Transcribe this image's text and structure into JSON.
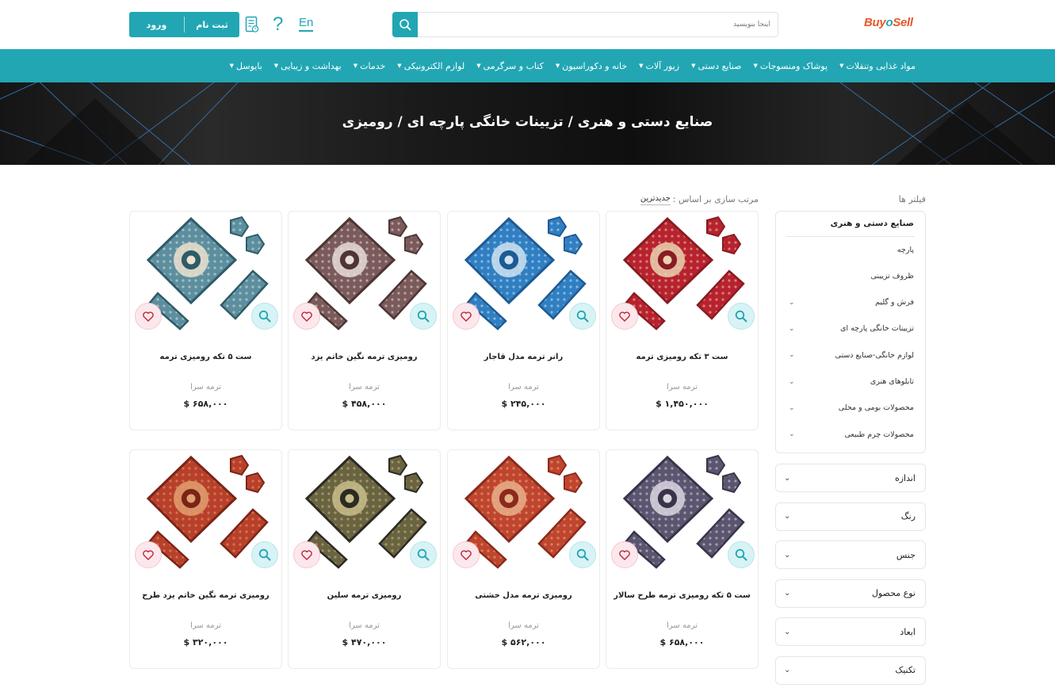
{
  "header": {
    "logo_part1": "Buy",
    "logo_o": "o",
    "logo_part2": "Sell",
    "search_placeholder": "اینجا بنویسید",
    "lang_link": "En",
    "help_glyph": "?",
    "register_label": "ثبت نام",
    "login_label": "ورود",
    "accent_color": "#22a6b3"
  },
  "nav": {
    "items": [
      {
        "label": "مواد غذایی وتنقلات"
      },
      {
        "label": "پوشاک ومنسوجات"
      },
      {
        "label": "صنایع دستی"
      },
      {
        "label": "زیور آلات"
      },
      {
        "label": "خانه و دکوراسیون"
      },
      {
        "label": "کتاب و سرگرمی"
      },
      {
        "label": "لوازم الکترونیکی"
      },
      {
        "label": "خدمات"
      },
      {
        "label": "بهداشت و زیبایی"
      },
      {
        "label": "بایوسل"
      }
    ]
  },
  "banner": {
    "title": "صنایع دستی و هنری / تزیینات خانگی پارچه ای / رومیزی"
  },
  "sidebar": {
    "filters_title": "فیلتر ها",
    "category_head": "صنایع دستی و هنری",
    "category_items": [
      {
        "label": "پارچه",
        "has_children": false
      },
      {
        "label": "ظروف تزیینی",
        "has_children": false
      },
      {
        "label": "فرش و گلیم",
        "has_children": true
      },
      {
        "label": "تزیینات خانگی پارچه ای",
        "has_children": true
      },
      {
        "label": "لوازم خانگی-صنایع دستی",
        "has_children": true
      },
      {
        "label": "تابلوهای هنری",
        "has_children": true
      },
      {
        "label": "محصولات بومی و محلی",
        "has_children": true
      },
      {
        "label": "محصولات چرم طبیعی",
        "has_children": true
      }
    ],
    "filter_groups": [
      {
        "label": "اندازه"
      },
      {
        "label": "رنگ"
      },
      {
        "label": "جنس"
      },
      {
        "label": "نوع محصول"
      },
      {
        "label": "ابعاد"
      },
      {
        "label": "تکنیک"
      }
    ]
  },
  "sort": {
    "label": "مرتب سازی بر اساس :",
    "value": "جدیدترین"
  },
  "products": [
    {
      "name": "ست ۳ تکه رومیزی ترمه",
      "brand": "ترمه سرا",
      "price": "$ ۱,۴۵۰,۰۰۰",
      "palette": [
        "#b8222e",
        "#e9d3b0",
        "#8a1b22"
      ]
    },
    {
      "name": "رانر ترمه مدل قاجار",
      "brand": "ترمه سرا",
      "price": "$ ۲۴۵,۰۰۰",
      "palette": [
        "#2f7fc2",
        "#cfe3f1",
        "#1e5a94"
      ]
    },
    {
      "name": "رومیزی ترمه نگین خاتم یزد",
      "brand": "ترمه سرا",
      "price": "$ ۴۵۸,۰۰۰",
      "palette": [
        "#7a5a5a",
        "#e8ddd8",
        "#4d3535"
      ]
    },
    {
      "name": "ست ۵ تکه رومیزی ترمه",
      "brand": "ترمه سرا",
      "price": "$ ۶۵۸,۰۰۰",
      "palette": [
        "#5b8fa0",
        "#ece2cf",
        "#2f5b68"
      ]
    },
    {
      "name": "ست ۵ تکه رومیزی ترمه طرح سالار",
      "brand": "ترمه سرا",
      "price": "$ ۶۵۸,۰۰۰",
      "palette": [
        "#5c5570",
        "#dcd6e0",
        "#3a344a"
      ]
    },
    {
      "name": "رومیزی ترمه مدل خشتی",
      "brand": "ترمه سرا",
      "price": "$ ۵۶۲,۰۰۰",
      "palette": [
        "#c0452e",
        "#e8b089",
        "#8a2a1c"
      ]
    },
    {
      "name": "رومیزی ترمه سلین",
      "brand": "ترمه سرا",
      "price": "$ ۴۷۰,۰۰۰",
      "palette": [
        "#6a6340",
        "#c9bd8c",
        "#2b2a24"
      ]
    },
    {
      "name": "رومیزی ترمه نگین خاتم یزد طرح",
      "brand": "ترمه سرا",
      "price": "$ ۳۲۰,۰۰۰",
      "palette": [
        "#b8402a",
        "#e0a070",
        "#7a2418"
      ]
    }
  ]
}
